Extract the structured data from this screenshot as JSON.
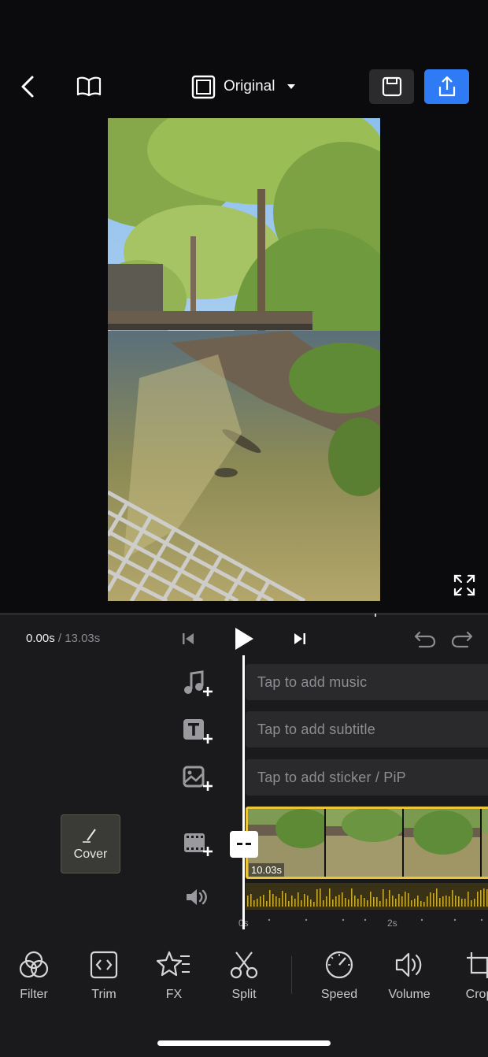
{
  "header": {
    "aspect_ratio_label": "Original"
  },
  "player": {
    "current_time": "0.00s",
    "separator": " / ",
    "total_time": "13.03s"
  },
  "tracks": {
    "music_placeholder": "Tap to add music",
    "subtitle_placeholder": "Tap to add subtitle",
    "sticker_placeholder": "Tap to add sticker / PiP"
  },
  "cover": {
    "label": "Cover"
  },
  "clip": {
    "duration": "10.03s"
  },
  "ruler": {
    "labels": [
      "0s",
      "2s"
    ]
  },
  "toolbar": {
    "items": [
      {
        "label": "Filter",
        "icon": "filter-icon"
      },
      {
        "label": "Trim",
        "icon": "trim-icon"
      },
      {
        "label": "FX",
        "icon": "fx-icon"
      },
      {
        "label": "Split",
        "icon": "split-icon"
      },
      {
        "label": "Speed",
        "icon": "speed-icon"
      },
      {
        "label": "Volume",
        "icon": "volume-icon"
      },
      {
        "label": "Crop",
        "icon": "crop-icon"
      }
    ]
  },
  "colors": {
    "accent_blue": "#2f7bf6",
    "clip_border": "#e8c53a",
    "panel_bg": "#1a1a1d"
  }
}
